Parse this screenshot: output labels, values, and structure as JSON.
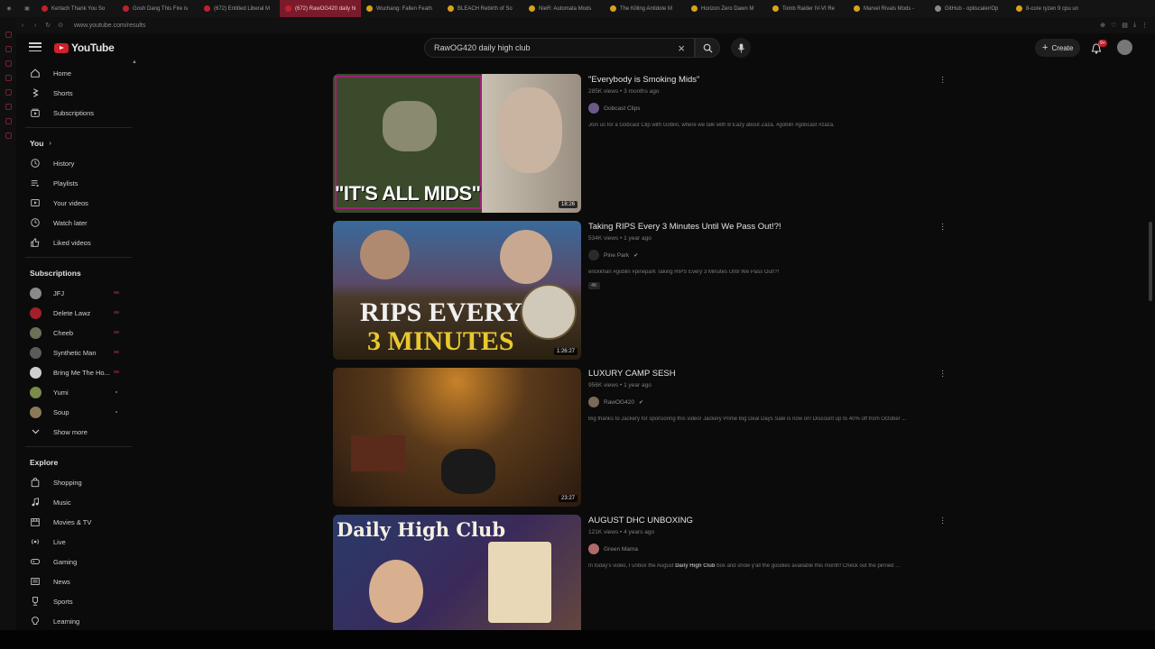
{
  "browser": {
    "tabs": [
      {
        "title": "Kerlach Thank You So",
        "color": "red"
      },
      {
        "title": "Gosh Dang This Fire is",
        "color": "red"
      },
      {
        "title": "(672) Entitled Liberal M",
        "color": "red"
      },
      {
        "title": "(672) RawOG420 daily hi",
        "color": "red",
        "active": true
      },
      {
        "title": "Wuchang: Fallen Feath",
        "color": "yellow"
      },
      {
        "title": "BLEACH Rebirth of So",
        "color": "yellow"
      },
      {
        "title": "NieR: Automata Mods",
        "color": "yellow"
      },
      {
        "title": "The Killing Antidote M",
        "color": "yellow"
      },
      {
        "title": "Horizon Zero Dawn M",
        "color": "yellow"
      },
      {
        "title": "Tomb Raider IV-VI Re",
        "color": "yellow"
      },
      {
        "title": "Marvel Rivals Mods -",
        "color": "yellow"
      },
      {
        "title": "GitHub - optiscaler/Op",
        "color": "grey"
      },
      {
        "title": "8-core ryzen 9 cpu un",
        "color": "yellow"
      }
    ],
    "url": "www.youtube.com/results"
  },
  "header": {
    "logo_text": "YouTube",
    "search_value": "RawOG420 daily high club",
    "create_label": "Create",
    "notification_count": "9+"
  },
  "sidebar": {
    "main": [
      {
        "label": "Home",
        "icon": "home-icon"
      },
      {
        "label": "Shorts",
        "icon": "shorts-icon"
      },
      {
        "label": "Subscriptions",
        "icon": "subscriptions-icon"
      }
    ],
    "you_title": "You",
    "you_items": [
      {
        "label": "History",
        "icon": "history-icon"
      },
      {
        "label": "Playlists",
        "icon": "playlists-icon"
      },
      {
        "label": "Your videos",
        "icon": "your-videos-icon"
      },
      {
        "label": "Watch later",
        "icon": "watch-later-icon"
      },
      {
        "label": "Liked videos",
        "icon": "liked-videos-icon"
      }
    ],
    "subscriptions_title": "Subscriptions",
    "subscriptions": [
      {
        "label": "JFJ",
        "avatar_color": "#8a8a8a",
        "indicator": "live"
      },
      {
        "label": "Delete Lawz",
        "avatar_color": "#a0202a",
        "indicator": "live"
      },
      {
        "label": "Cheeb",
        "avatar_color": "#6c7058",
        "indicator": "live"
      },
      {
        "label": "Synthetic Man",
        "avatar_color": "#5a5a5a",
        "indicator": "live"
      },
      {
        "label": "Bring Me The Ho...",
        "avatar_color": "#cfcfcf",
        "indicator": "live"
      },
      {
        "label": "Yumi",
        "avatar_color": "#7a8a4a",
        "indicator": "new"
      },
      {
        "label": "Soup",
        "avatar_color": "#8a7a5a",
        "indicator": "new"
      }
    ],
    "show_more_label": "Show more",
    "explore_title": "Explore",
    "explore": [
      {
        "label": "Shopping",
        "icon": "shopping-bag-icon"
      },
      {
        "label": "Music",
        "icon": "music-note-icon"
      },
      {
        "label": "Movies & TV",
        "icon": "movies-icon"
      },
      {
        "label": "Live",
        "icon": "live-icon"
      },
      {
        "label": "Gaming",
        "icon": "gaming-icon"
      },
      {
        "label": "News",
        "icon": "news-icon"
      },
      {
        "label": "Sports",
        "icon": "sports-trophy-icon"
      },
      {
        "label": "Learning",
        "icon": "learning-icon"
      }
    ]
  },
  "results": [
    {
      "title": "\"Everybody is Smoking Mids\"",
      "views": "285K views",
      "age": "3 months ago",
      "channel": "Gobcast Clips",
      "verified": false,
      "description": "Join us for a Gobcast Clip with Goblin, where we talk with B Eazy about Zaza. #goblin #gobcast #zaza.",
      "badge": "",
      "duration": "18:26",
      "thumb_text": "\"IT'S ALL MIDS\"",
      "thumb_colors": [
        "#3a4a2a",
        "#c8c0b0"
      ],
      "channel_color": "#6a5a8a"
    },
    {
      "title": "Taking RIPS Every 3 Minutes Until We Pass Out!?!",
      "views": "534K views",
      "age": "1 year ago",
      "channel": "Pine Park",
      "verified": true,
      "description": "erickkhan #goblin #pinepark Taking RIPS Every 3 Minutes Until We Pass Out!?!",
      "badge": "4K",
      "duration": "1:26:27",
      "thumb_text": "RIPS EVERY",
      "thumb_text2": "3 MINUTES",
      "thumb_colors": [
        "#3a6a9a",
        "#4a3a2a"
      ],
      "channel_color": "#2a2a2a"
    },
    {
      "title": "LUXURY CAMP SESH",
      "views": "956K views",
      "age": "1 year ago",
      "channel": "RawOG420",
      "verified": true,
      "description": "Big thanks to Jackery for sponsoring this video! Jackery Prime Big Deal Days Sale is now on! Discount up to 40% off from October ...",
      "badge": "",
      "duration": "23:27",
      "thumb_text": "",
      "thumb_colors": [
        "#5a3a1a",
        "#2a1a10"
      ],
      "channel_color": "#7a6a5a"
    },
    {
      "title": "AUGUST DHC UNBOXING",
      "views": "121K views",
      "age": "4 years ago",
      "channel": "Green Mama",
      "verified": false,
      "description_pre": "In today's video, I unbox the August ",
      "description_bold": "Daily High Club",
      "description_post": " box and show y'all the goodies available this month! Check out the pinned ...",
      "badge": "",
      "duration": "",
      "thumb_text": "Daily High Club",
      "thumb_colors": [
        "#2a3a6a",
        "#6a4a3a"
      ],
      "channel_color": "#b06a6a"
    }
  ]
}
